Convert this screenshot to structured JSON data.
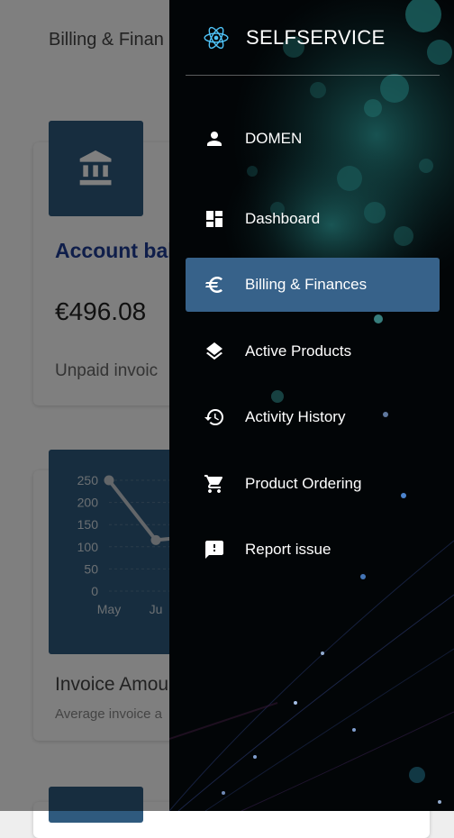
{
  "background": {
    "page_title": "Billing & Finan",
    "account_card": {
      "title": "Account bal",
      "balance": "€496.08",
      "unpaid": "Unpaid invoic",
      "icon": "bank-icon"
    },
    "invoice_card": {
      "title": "Invoice Amou",
      "subtitle": "Average invoice a",
      "chart_data": {
        "type": "line",
        "categories": [
          "May",
          "Ju"
        ],
        "values": [
          250,
          115
        ],
        "ylim": [
          0,
          250
        ],
        "yticks": [
          "250",
          "200",
          "150",
          "100",
          "50",
          "0"
        ],
        "grid": true
      }
    }
  },
  "drawer": {
    "brand": "SELFSERVICE",
    "brand_icon": "react-atom-icon",
    "items": [
      {
        "label": "DOMEN",
        "icon": "person-icon",
        "active": false
      },
      {
        "label": "Dashboard",
        "icon": "dashboard-icon",
        "active": false
      },
      {
        "label": "Billing & Finances",
        "icon": "euro-icon",
        "active": true
      },
      {
        "label": "Active Products",
        "icon": "layers-icon",
        "active": false
      },
      {
        "label": "Activity History",
        "icon": "history-icon",
        "active": false
      },
      {
        "label": "Product Ordering",
        "icon": "cart-icon",
        "active": false
      },
      {
        "label": "Report issue",
        "icon": "feedback-icon",
        "active": false
      }
    ],
    "colors": {
      "active": "#37628a",
      "bg": "#020507",
      "brand_icon": "#4fc3f7"
    }
  }
}
